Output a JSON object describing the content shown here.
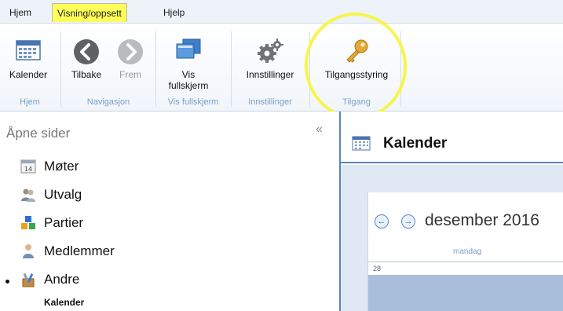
{
  "menu": {
    "items": [
      {
        "label": "Hjem"
      },
      {
        "label": "Visning/oppsett",
        "active": true
      },
      {
        "label": "Hjelp"
      }
    ]
  },
  "ribbon": {
    "buttons": {
      "kalender": "Kalender",
      "tilbake": "Tilbake",
      "frem": "Frem",
      "vis_fullskjerm_line1": "Vis",
      "vis_fullskjerm_line2": "fullskjerm",
      "innstillinger": "Innstillinger",
      "tilgangsstyring": "Tilgangsstyring"
    },
    "groups": {
      "hjem": "Hjem",
      "navigasjon": "Navigasjon",
      "vis_fullskjerm": "Vis fullskjerm",
      "innstillinger": "Innstillinger",
      "tilgang": "Tilgang"
    },
    "highlight_color": "#f5f53a"
  },
  "sidebar": {
    "title": "Åpne sider",
    "collapse_glyph": "«",
    "items": [
      {
        "label": "Møter",
        "icon": "calendar-14-icon"
      },
      {
        "label": "Utvalg",
        "icon": "people-icon"
      },
      {
        "label": "Partier",
        "icon": "blocks-icon"
      },
      {
        "label": "Medlemmer",
        "icon": "person-icon"
      },
      {
        "label": "Andre",
        "icon": "tools-icon"
      }
    ],
    "sub_item": "Kalender"
  },
  "main": {
    "title": "Kalender",
    "calendar": {
      "month": "desember 2016",
      "prev": "←",
      "next": "→",
      "weekday": "mandag",
      "first_date": "28"
    }
  },
  "colors": {
    "menu_active": "#ffff5a",
    "accent": "#5c84b8",
    "group_label": "#7aa0c8"
  }
}
